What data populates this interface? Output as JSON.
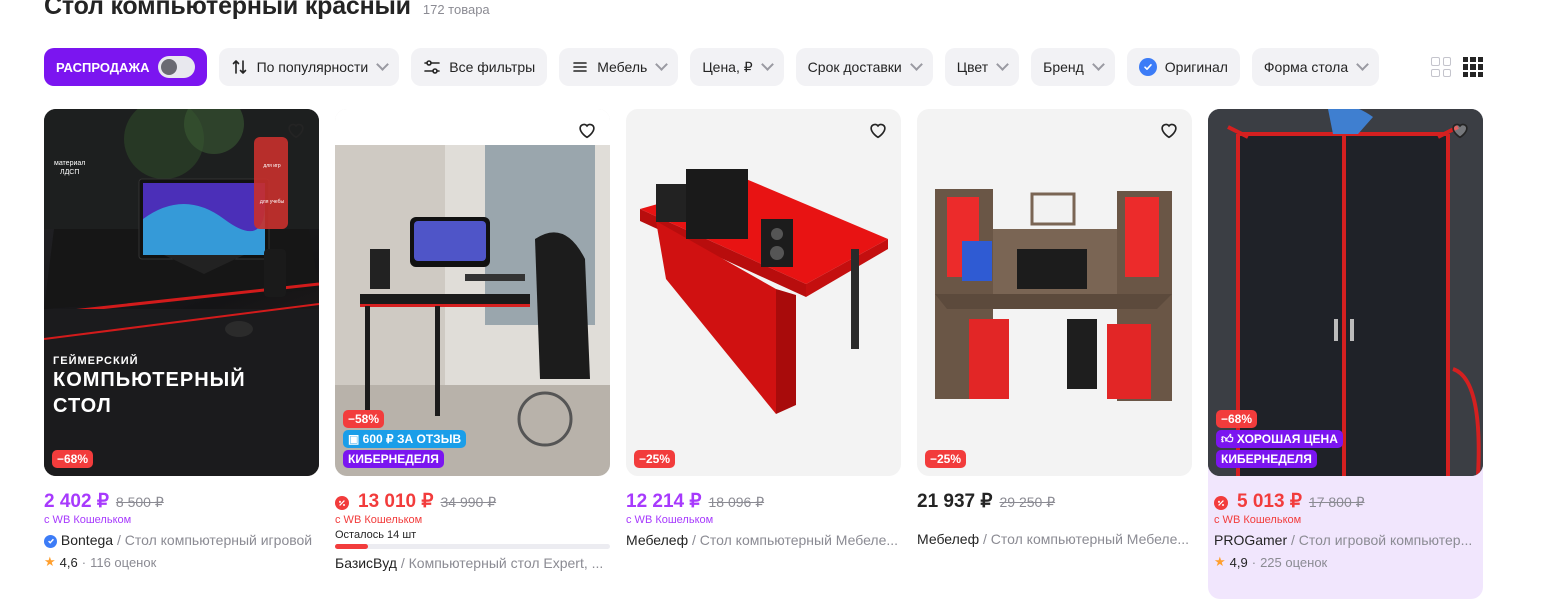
{
  "page": {
    "title": "Стол компьютерный красный",
    "count": "172 товара"
  },
  "filters": {
    "sale_label": "РАСПРОДАЖА",
    "sort_label": "По популярности",
    "all_filters_label": "Все фильтры",
    "category_label": "Мебель",
    "price_label": "Цена, ₽",
    "delivery_label": "Срок доставки",
    "color_label": "Цвет",
    "brand_label": "Бренд",
    "original_label": "Оригинал",
    "shape_label": "Форма стола"
  },
  "colors": {
    "accent": "#7b15f0",
    "price_purple": "#a73afd",
    "discount_red": "#f23c3c",
    "chip_bg": "#f2f2f5"
  },
  "products": [
    {
      "discount": "−68%",
      "promo_small": "ГЕЙМЕРСКИЙ",
      "promo_line1": "КОМПЬЮТЕРНЫЙ",
      "promo_line2": "СТОЛ",
      "material_line1": "материал",
      "material_line2": "ЛДСП",
      "tag_games": "для игр",
      "tag_study": "для учебы",
      "price": "2 402 ₽",
      "old_price": "8 500 ₽",
      "wallet": "с WB Кошельком",
      "brand": "Bontega",
      "name": "Стол компьютерный игровой",
      "rating": "4,6",
      "reviews": "116 оценок"
    },
    {
      "discount": "−58%",
      "badge_review": "600 ₽ ЗА ОТЗЫВ",
      "badge_event": "КИБЕРНЕДЕЛЯ",
      "price": "13 010 ₽",
      "old_price": "34 990 ₽",
      "wallet": "с WB Кошельком",
      "stock": "Осталось 14 шт",
      "stock_fill": 0.12,
      "brand": "БазисВуд",
      "name": "Компьютерный стол Expert, ..."
    },
    {
      "discount": "−25%",
      "price": "12 214 ₽",
      "old_price": "18 096 ₽",
      "wallet": "с WB Кошельком",
      "brand": "Мебелеф",
      "name": "Стол компьютерный Мебеле..."
    },
    {
      "discount": "−25%",
      "price": "21 937 ₽",
      "old_price": "29 250 ₽",
      "brand": "Мебелеф",
      "name": "Стол компьютерный Мебеле..."
    },
    {
      "discount": "−68%",
      "badge_good": "ХОРОШАЯ ЦЕНА",
      "badge_event": "КИБЕРНЕДЕЛЯ",
      "price": "5 013 ₽",
      "old_price": "17 800 ₽",
      "wallet": "с WB Кошельком",
      "brand": "PROGamer",
      "name": "Стол игровой компьютер...",
      "rating": "4,9",
      "reviews": "225 оценок"
    }
  ]
}
